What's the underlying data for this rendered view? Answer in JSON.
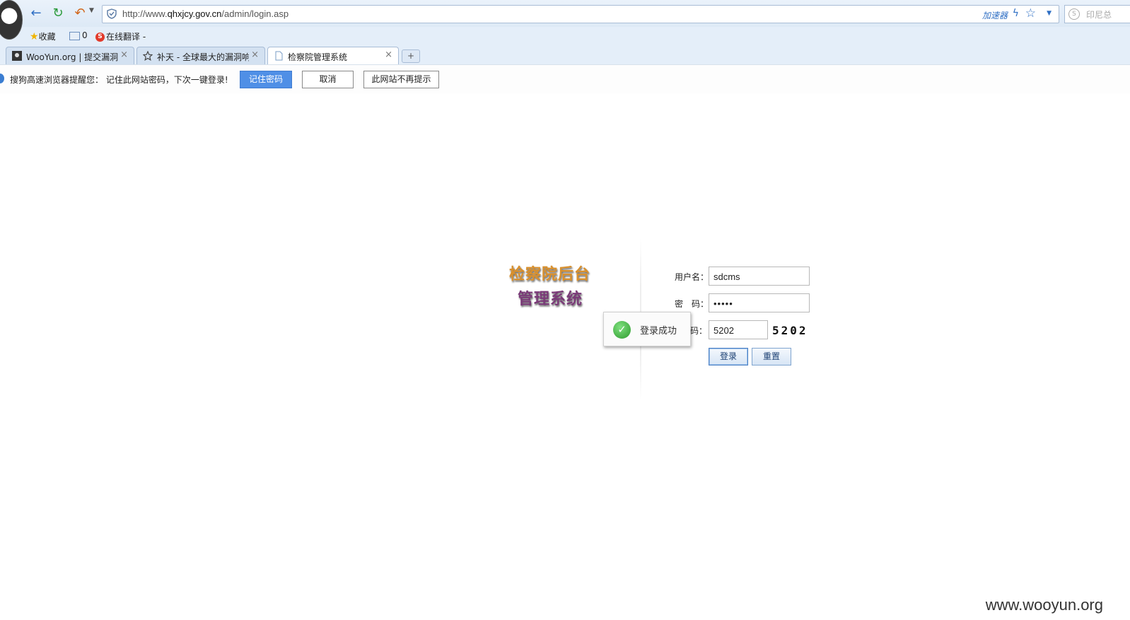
{
  "browser": {
    "url_prefix": "http://www.",
    "url_host": "qhxjcy.gov.cn",
    "url_path": "/admin/login.asp",
    "accelerator_label": "加速器",
    "search_placeholder": "印尼总",
    "favorites": {
      "collect_label": "收藏",
      "folder_count": "0",
      "translate_label": "在线翻译 -"
    },
    "tabs": [
      {
        "label": "WooYun.org | 提交漏洞",
        "close": "×"
      },
      {
        "label": "补天 - 全球最大的漏洞响",
        "close": "×"
      },
      {
        "label": "检察院管理系统",
        "close": "×"
      }
    ],
    "new_tab_label": "+",
    "password_bar": {
      "message": "搜狗高速浏览器提醒您： 记住此网站密码，下次一键登录!",
      "remember_label": "记住密码",
      "cancel_label": "取消",
      "never_label": "此网站不再提示"
    }
  },
  "page": {
    "title_line1": "检察院后台",
    "title_line2": "管理系统",
    "username_label": "用户名：",
    "username_value": "sdcms",
    "password_label": "密　码：",
    "password_value": "•••••",
    "captcha_label": "码：",
    "captcha_value": "5202",
    "captcha_image_text": "5202",
    "login_label": "登录",
    "reset_label": "重置",
    "toast_message": "登录成功"
  },
  "watermark": "www.wooyun.org"
}
